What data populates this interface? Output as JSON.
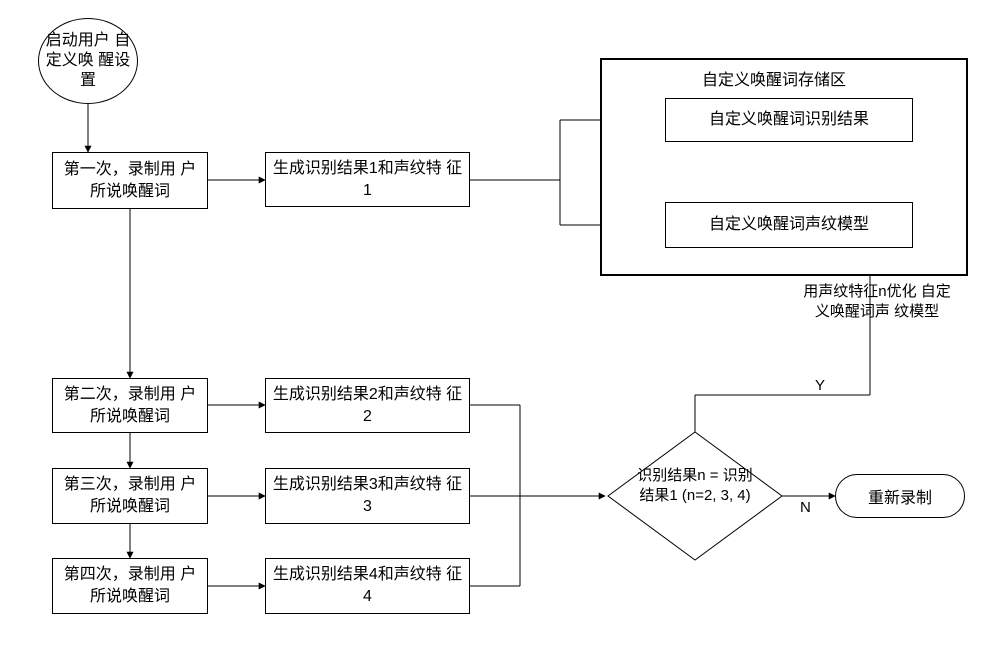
{
  "start": {
    "label": "启动用户\n自定义唤\n醒设置"
  },
  "record": {
    "r1": "第一次，录制用\n户所说唤醒词",
    "r2": "第二次，录制用\n户所说唤醒词",
    "r3": "第三次，录制用\n户所说唤醒词",
    "r4": "第四次，录制用\n户所说唤醒词"
  },
  "gen": {
    "g1": "生成识别结果1和声纹特\n征1",
    "g2": "生成识别结果2和声纹特\n征2",
    "g3": "生成识别结果3和声纹特\n征3",
    "g4": "生成识别结果4和声纹特\n征4"
  },
  "decision": "识别结果n =\n识别结果1\n(n=2, 3, 4)",
  "branch": {
    "yes": "Y",
    "no": "N"
  },
  "rerecord": "重新录制",
  "storage": {
    "title": "自定义唤醒词存储区",
    "result": "自定义唤醒词识别结果",
    "model": "自定义唤醒词声纹模型"
  },
  "opt_note": "用声纹特征n优化\n自定义唤醒词声\n纹模型",
  "chart_data": {
    "type": "flowchart",
    "nodes": [
      {
        "id": "start",
        "type": "terminator",
        "text": "启动用户自定义唤醒设置"
      },
      {
        "id": "rec1",
        "type": "process",
        "text": "第一次，录制用户所说唤醒词"
      },
      {
        "id": "rec2",
        "type": "process",
        "text": "第二次，录制用户所说唤醒词"
      },
      {
        "id": "rec3",
        "type": "process",
        "text": "第三次，录制用户所说唤醒词"
      },
      {
        "id": "rec4",
        "type": "process",
        "text": "第四次，录制用户所说唤醒词"
      },
      {
        "id": "gen1",
        "type": "process",
        "text": "生成识别结果1和声纹特征1"
      },
      {
        "id": "gen2",
        "type": "process",
        "text": "生成识别结果2和声纹特征2"
      },
      {
        "id": "gen3",
        "type": "process",
        "text": "生成识别结果3和声纹特征3"
      },
      {
        "id": "gen4",
        "type": "process",
        "text": "生成识别结果4和声纹特征4"
      },
      {
        "id": "dec",
        "type": "decision",
        "text": "识别结果n = 识别结果1 (n=2,3,4)"
      },
      {
        "id": "rerec",
        "type": "terminator",
        "text": "重新录制"
      },
      {
        "id": "storeRegion",
        "type": "region",
        "text": "自定义唤醒词存储区"
      },
      {
        "id": "storeResult",
        "type": "process",
        "text": "自定义唤醒词识别结果"
      },
      {
        "id": "storeModel",
        "type": "process",
        "text": "自定义唤醒词声纹模型"
      }
    ],
    "edges": [
      {
        "from": "start",
        "to": "rec1"
      },
      {
        "from": "rec1",
        "to": "gen1"
      },
      {
        "from": "rec1",
        "to": "rec2"
      },
      {
        "from": "rec2",
        "to": "gen2"
      },
      {
        "from": "rec2",
        "to": "rec3"
      },
      {
        "from": "rec3",
        "to": "gen3"
      },
      {
        "from": "rec3",
        "to": "rec4"
      },
      {
        "from": "rec4",
        "to": "gen4"
      },
      {
        "from": "gen1",
        "to": "storeResult"
      },
      {
        "from": "gen1",
        "to": "storeModel"
      },
      {
        "from": "gen2",
        "to": "dec"
      },
      {
        "from": "gen3",
        "to": "dec"
      },
      {
        "from": "gen4",
        "to": "dec"
      },
      {
        "from": "dec",
        "to": "storeModel",
        "label": "Y",
        "note": "用声纹特征n优化自定义唤醒词声纹模型"
      },
      {
        "from": "dec",
        "to": "rerec",
        "label": "N"
      }
    ]
  }
}
